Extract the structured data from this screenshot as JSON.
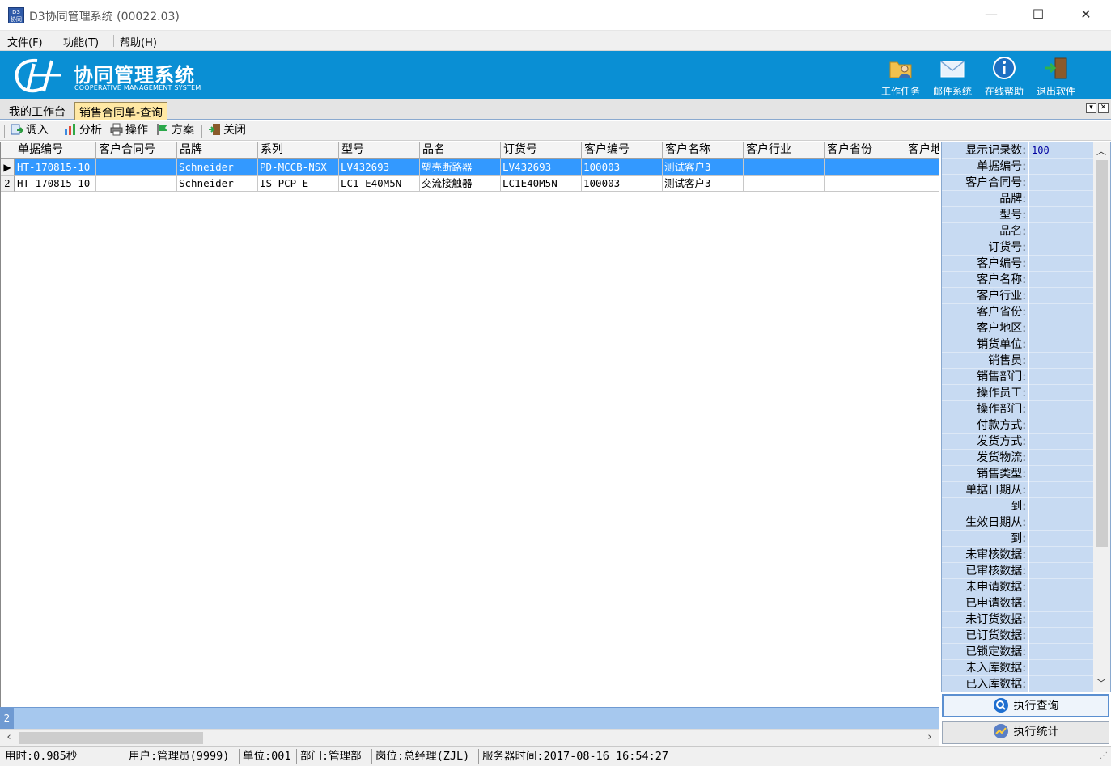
{
  "window": {
    "title": "D3协同管理系统 (00022.03)",
    "minimize_glyph": "—",
    "maximize_glyph": "☐",
    "close_glyph": "✕"
  },
  "menu": [
    "文件(F)",
    "功能(T)",
    "帮助(H)"
  ],
  "banner": {
    "title": "协同管理系统",
    "subtitle": "COOPERATIVE MANAGEMENT SYSTEM",
    "buttons": [
      {
        "label": "工作任务",
        "icon": "task-folder-icon"
      },
      {
        "label": "邮件系统",
        "icon": "mail-icon"
      },
      {
        "label": "在线帮助",
        "icon": "info-icon"
      },
      {
        "label": "退出软件",
        "icon": "exit-door-icon"
      }
    ]
  },
  "tabs": [
    {
      "label": "我的工作台",
      "active": false
    },
    {
      "label": "销售合同单-查询",
      "active": true
    }
  ],
  "toolbar": [
    {
      "label": "调入",
      "icon": "import-icon"
    },
    {
      "label": "分析",
      "icon": "chart-icon"
    },
    {
      "label": "操作",
      "icon": "printer-icon"
    },
    {
      "label": "方案",
      "icon": "flag-icon"
    },
    {
      "label": "关闭",
      "icon": "close-door-icon"
    }
  ],
  "grid": {
    "columns": [
      "单据编号",
      "客户合同号",
      "品牌",
      "系列",
      "型号",
      "品名",
      "订货号",
      "客户编号",
      "客户名称",
      "客户行业",
      "客户省份",
      "客户地"
    ],
    "rows": [
      {
        "marker": "▶",
        "cells": [
          "HT-170815-10",
          "",
          "Schneider",
          "PD-MCCB-NSX",
          "LV432693",
          "塑壳断路器",
          "LV432693",
          "100003",
          "测试客户3",
          "",
          "",
          ""
        ]
      },
      {
        "marker": "2",
        "cells": [
          "HT-170815-10",
          "",
          "Schneider",
          "IS-PCP-E",
          "LC1-E40M5N",
          "交流接触器",
          "LC1E40M5N",
          "100003",
          "测试客户3",
          "",
          "",
          ""
        ]
      }
    ],
    "record_count": "2"
  },
  "filter": {
    "fields": [
      {
        "label": "显示记录数:",
        "value": "100"
      },
      {
        "label": "单据编号:",
        "value": ""
      },
      {
        "label": "客户合同号:",
        "value": ""
      },
      {
        "label": "品牌:",
        "value": ""
      },
      {
        "label": "型号:",
        "value": ""
      },
      {
        "label": "品名:",
        "value": ""
      },
      {
        "label": "订货号:",
        "value": ""
      },
      {
        "label": "客户编号:",
        "value": ""
      },
      {
        "label": "客户名称:",
        "value": ""
      },
      {
        "label": "客户行业:",
        "value": ""
      },
      {
        "label": "客户省份:",
        "value": ""
      },
      {
        "label": "客户地区:",
        "value": ""
      },
      {
        "label": "销货单位:",
        "value": ""
      },
      {
        "label": "销售员:",
        "value": ""
      },
      {
        "label": "销售部门:",
        "value": ""
      },
      {
        "label": "操作员工:",
        "value": ""
      },
      {
        "label": "操作部门:",
        "value": ""
      },
      {
        "label": "付款方式:",
        "value": ""
      },
      {
        "label": "发货方式:",
        "value": ""
      },
      {
        "label": "发货物流:",
        "value": ""
      },
      {
        "label": "销售类型:",
        "value": ""
      },
      {
        "label": "单据日期从:",
        "value": ""
      },
      {
        "label": "到:",
        "value": ""
      },
      {
        "label": "生效日期从:",
        "value": ""
      },
      {
        "label": "到:",
        "value": ""
      }
    ],
    "checkboxes": [
      {
        "label": "未审核数据:",
        "checked": false
      },
      {
        "label": "已审核数据:",
        "checked": false
      },
      {
        "label": "未申请数据:",
        "checked": false
      },
      {
        "label": "已申请数据:",
        "checked": false
      },
      {
        "label": "未订货数据:",
        "checked": false
      },
      {
        "label": "已订货数据:",
        "checked": false
      },
      {
        "label": "已锁定数据:",
        "checked": false
      },
      {
        "label": "未入库数据:",
        "checked": false
      },
      {
        "label": "已入库数据:",
        "checked": false
      }
    ]
  },
  "actions": {
    "query": "执行查询",
    "stats": "执行统计"
  },
  "status": [
    "用时:0.985秒",
    "用户:管理员(9999)",
    "单位:001",
    "部门:管理部",
    "岗位:总经理(ZJL)",
    "服务器时间:2017-08-16 16:54:27"
  ],
  "colors": {
    "banner": "#0a8fd4",
    "selection": "#3399ff",
    "filter_field": "#c7daf2",
    "active_tab": "#ffe8a4"
  }
}
